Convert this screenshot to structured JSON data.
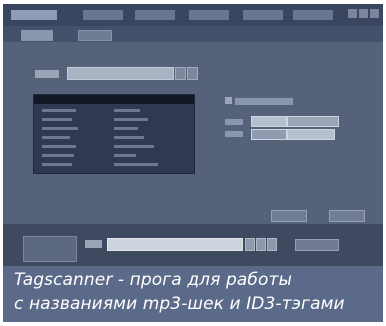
{
  "caption": {
    "line1": "Tagscanner - прога для работы",
    "line2": "с названиями mp3-шек и ID3-тэгами"
  },
  "colors": {
    "window_bg": "#4c5970",
    "caption_bg": "#5c6a89",
    "caption_text": "#ffffff"
  }
}
